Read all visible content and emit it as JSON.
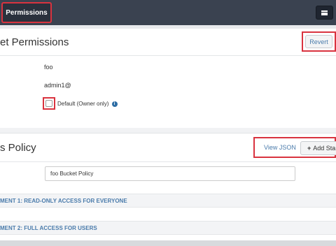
{
  "topbar": {
    "tab_label": "Permissions"
  },
  "bucket_permissions": {
    "title": "et Permissions",
    "revert_label": "Revert",
    "owner": "foo",
    "admin": "admin1@",
    "default_label": "Default (Owner only)",
    "default_checked": false
  },
  "access_policy": {
    "title": "s Policy",
    "view_json_label": "View JSON",
    "add_statement_label": "Add Sta",
    "policy_name_value": "foo Bucket Policy",
    "statements": [
      {
        "label": "MENT 1: READ-ONLY ACCESS FOR EVERYONE"
      },
      {
        "label": "MENT 2: FULL ACCESS FOR USERS"
      }
    ]
  },
  "colors": {
    "topbar": "#3a4250",
    "highlight": "#d9333f",
    "link": "#4a7bab"
  }
}
